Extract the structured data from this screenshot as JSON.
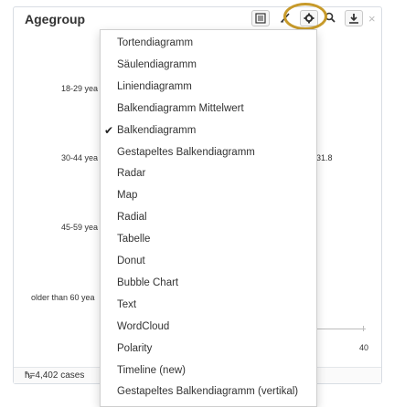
{
  "panel": {
    "title": "Agegroup",
    "footer": "n=4,402 cases"
  },
  "chart_data": {
    "type": "bar",
    "categories": [
      "18-29 yea",
      "30-44 yea",
      "45-59 yea",
      "older than 60 yea"
    ],
    "visible_value": "31.8",
    "x_tick": "40"
  },
  "menu": {
    "items": [
      {
        "label": "Tortendiagramm",
        "checked": false
      },
      {
        "label": "Säulendiagramm",
        "checked": false
      },
      {
        "label": "Liniendiagramm",
        "checked": false
      },
      {
        "label": "Balkendiagramm Mittelwert",
        "checked": false
      },
      {
        "label": "Balkendiagramm",
        "checked": true
      },
      {
        "label": "Gestapeltes Balkendiagramm",
        "checked": false
      },
      {
        "label": "Radar",
        "checked": false
      },
      {
        "label": "Map",
        "checked": false
      },
      {
        "label": "Radial",
        "checked": false
      },
      {
        "label": "Tabelle",
        "checked": false
      },
      {
        "label": "Donut",
        "checked": false
      },
      {
        "label": "Bubble Chart",
        "checked": false
      },
      {
        "label": "Text",
        "checked": false
      },
      {
        "label": "WordCloud",
        "checked": false
      },
      {
        "label": "Polarity",
        "checked": false
      },
      {
        "label": "Timeline (new)",
        "checked": false
      },
      {
        "label": "Gestapeltes Balkendiagramm (vertikal)",
        "checked": false
      }
    ],
    "check_glyph": "✔"
  },
  "toolbar": {
    "close_glyph": "×",
    "resize_glyph": "⤡"
  },
  "colors": {
    "highlight": "#c79a2a"
  }
}
